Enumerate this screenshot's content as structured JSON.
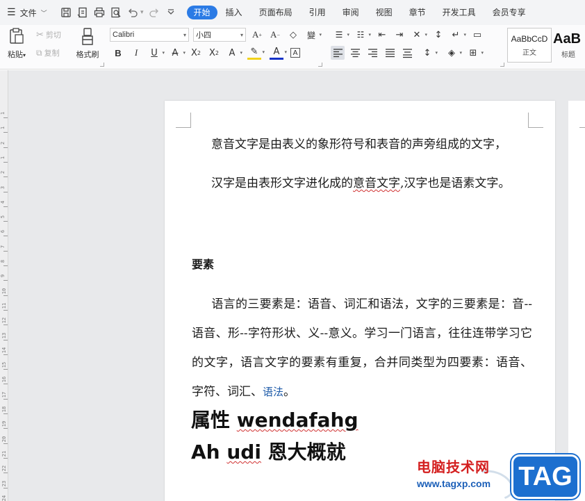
{
  "menu": {
    "file_label": "文件",
    "tabs": [
      {
        "label": "开始",
        "active": true
      },
      {
        "label": "插入"
      },
      {
        "label": "页面布局"
      },
      {
        "label": "引用"
      },
      {
        "label": "审阅"
      },
      {
        "label": "视图"
      },
      {
        "label": "章节"
      },
      {
        "label": "开发工具"
      },
      {
        "label": "会员专享"
      }
    ]
  },
  "ribbon": {
    "paste_label": "粘贴",
    "cut_label": "剪切",
    "copy_label": "复制",
    "format_painter_label": "格式刷",
    "font_name": "Calibri",
    "font_size": "小四",
    "styles": [
      {
        "sample": "AaBbCcD",
        "name": "正文"
      },
      {
        "sample": "AaB",
        "name": "标题"
      }
    ],
    "accent_color": "#2b7be5"
  },
  "document": {
    "para1": "意音文字是由表义的象形符号和表音的声旁组成的文字，",
    "para2_a": "汉字是由表形文字进化成的",
    "para2_squiggle": "意音文字",
    "para2_b": ",汉字也是语素文字。",
    "heading": "要素",
    "body_text": "语言的三要素是：语音、词汇和语法，文字的三要素是：音--语音、形--字符形状、义--意义。学习一门语言，往往连带学习它的文字，语言文字的要素有重复，合并同类型为四要素：语音、字符、词汇、",
    "body_link": "语法",
    "body_end": "。",
    "big1_a": "属性 ",
    "big1_squiggle": "wendafahg",
    "big2_a": "Ah ",
    "big2_squiggle": "udi",
    "big2_b": " 恩大概就"
  },
  "watermark": {
    "site_cn": "电脑技术网",
    "url": "www.tagxp.com",
    "tag": "TAG"
  },
  "ruler_ticks": [
    "1",
    "1",
    "2",
    "1",
    "2",
    "3",
    "4",
    "5",
    "6",
    "7",
    "8",
    "9",
    "10",
    "11",
    "12",
    "13",
    "14",
    "15",
    "16",
    "17",
    "18",
    "19",
    "20",
    "21",
    "22",
    "23",
    "24",
    "25"
  ]
}
